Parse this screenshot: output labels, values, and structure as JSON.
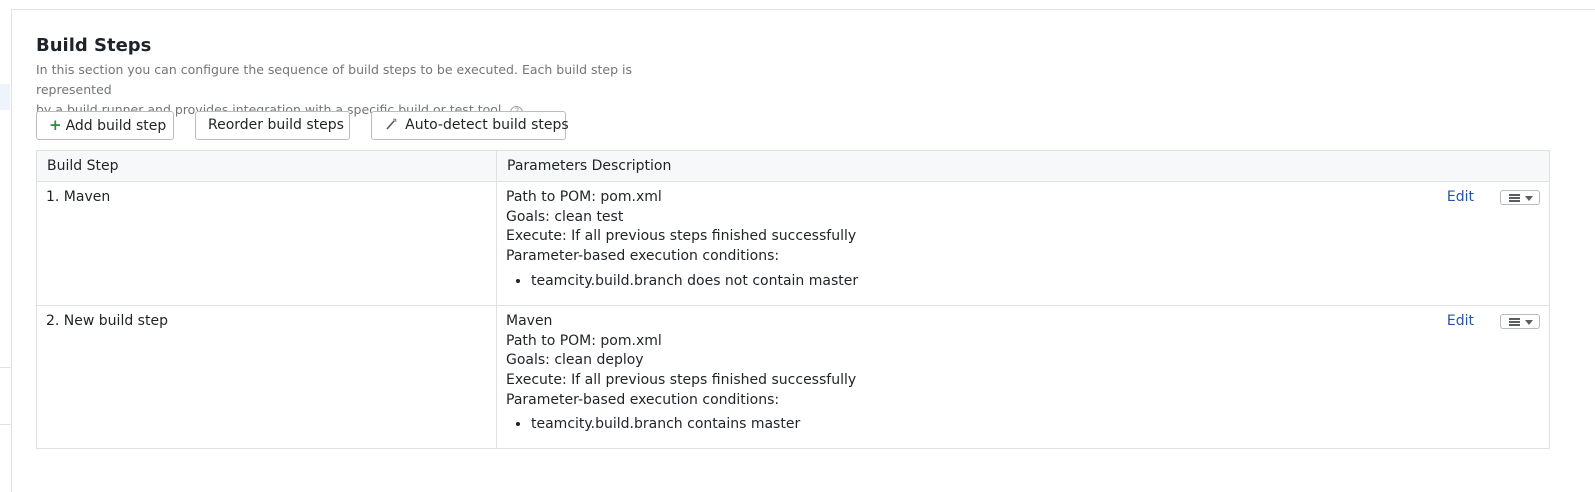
{
  "section": {
    "title": "Build Steps",
    "description_line1": "In this section you can configure the sequence of build steps to be executed. Each build step is represented",
    "description_line2": "by a build runner and provides integration with a specific build or test tool.",
    "help_glyph": "?"
  },
  "toolbar": {
    "add_label": "Add build step",
    "reorder_label": "Reorder build steps",
    "autodetect_label": "Auto-detect build steps"
  },
  "table": {
    "headers": [
      "Build Step",
      "Parameters Description"
    ],
    "rows": [
      {
        "name": "1. Maven",
        "lines": [
          "Path to POM: pom.xml",
          "Goals: clean test",
          "Execute: If all previous steps finished successfully",
          "Parameter-based execution conditions:"
        ],
        "conditions": [
          "teamcity.build.branch does not contain master"
        ],
        "edit_label": "Edit"
      },
      {
        "name": "2. New build step",
        "lines": [
          "Maven",
          "Path to POM: pom.xml",
          "Goals: clean deploy",
          "Execute: If all previous steps finished successfully",
          "Parameter-based execution conditions:"
        ],
        "conditions": [
          "teamcity.build.branch contains master"
        ],
        "edit_label": "Edit"
      }
    ]
  },
  "icons": {
    "add": "plus-icon",
    "autodetect": "magic-wand-icon",
    "help": "help-icon",
    "row_menu": "list-menu-icon",
    "dropdown": "chevron-down-icon"
  },
  "colors": {
    "accent_link": "#2455a8",
    "add_icon": "#2e8b3a",
    "border": "#dfe1e5",
    "header_bg": "#f7f8fa"
  }
}
